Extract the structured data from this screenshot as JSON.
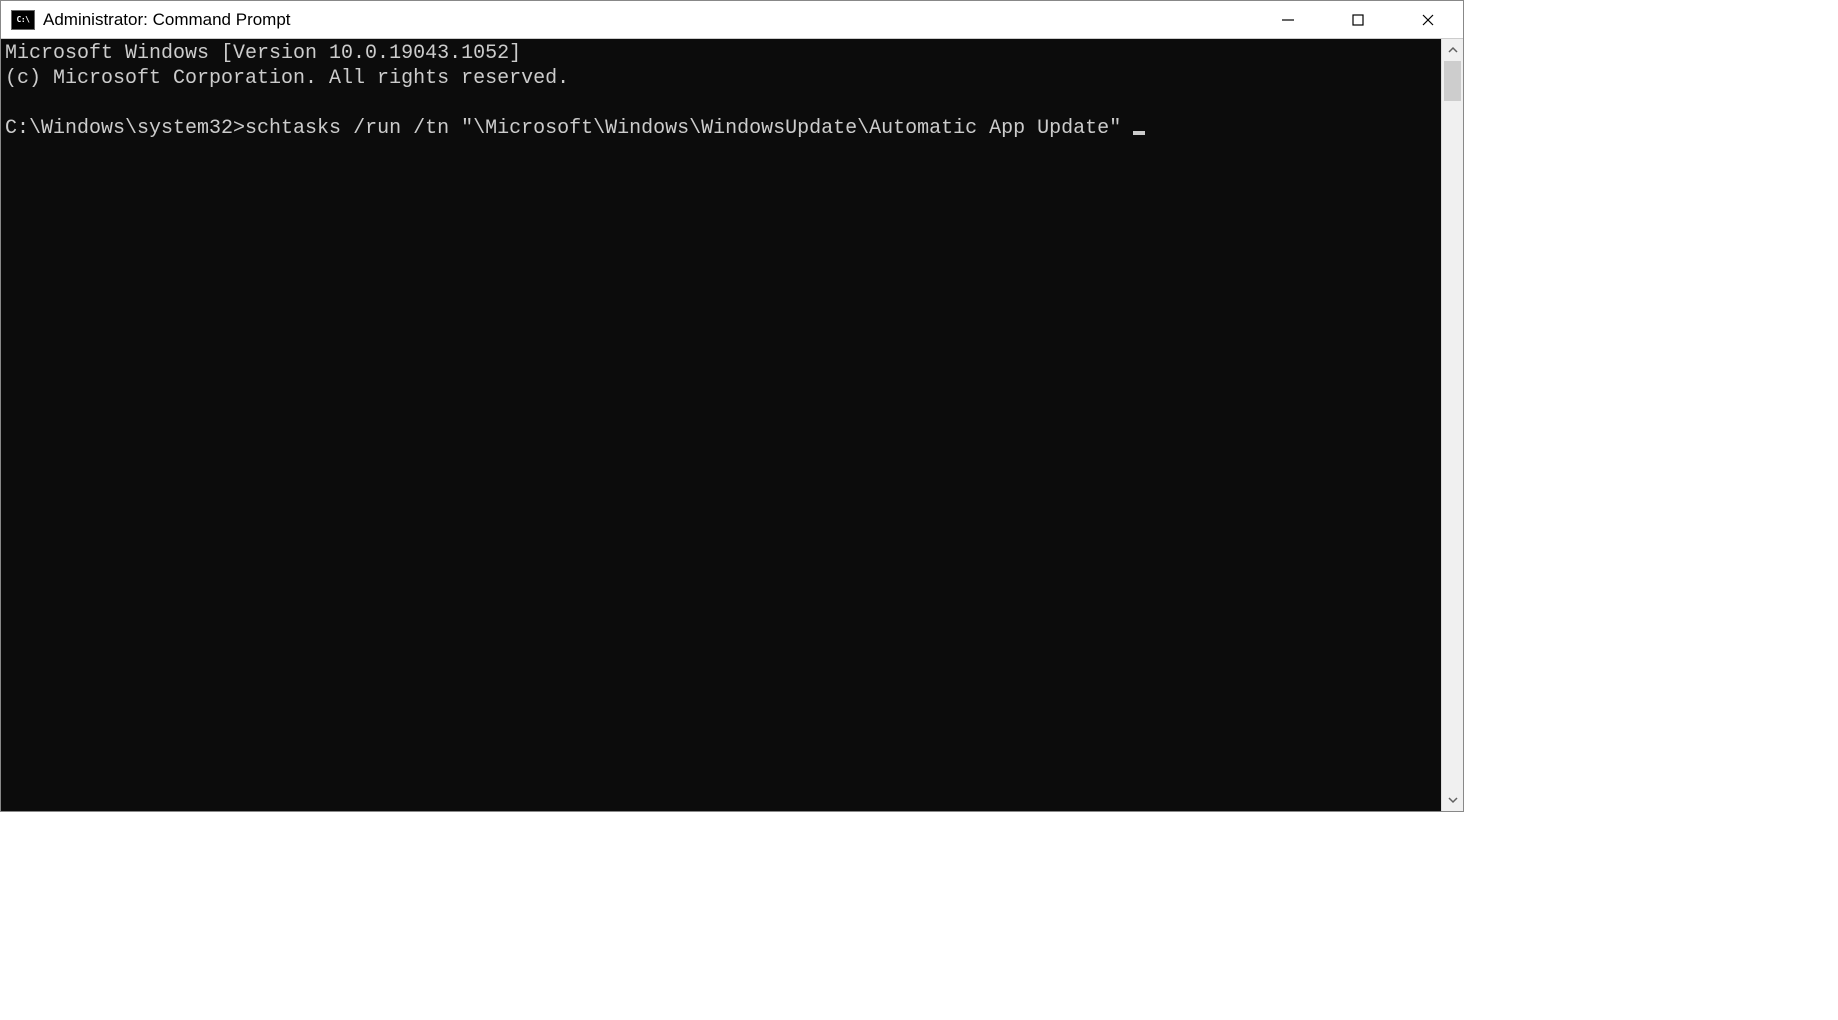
{
  "window": {
    "title": "Administrator: Command Prompt",
    "icon_label": "C:\\"
  },
  "terminal": {
    "line1": "Microsoft Windows [Version 10.0.19043.1052]",
    "line2": "(c) Microsoft Corporation. All rights reserved.",
    "prompt": "C:\\Windows\\system32>",
    "command": "schtasks /run /tn \"\\Microsoft\\Windows\\WindowsUpdate\\Automatic App Update\" "
  }
}
